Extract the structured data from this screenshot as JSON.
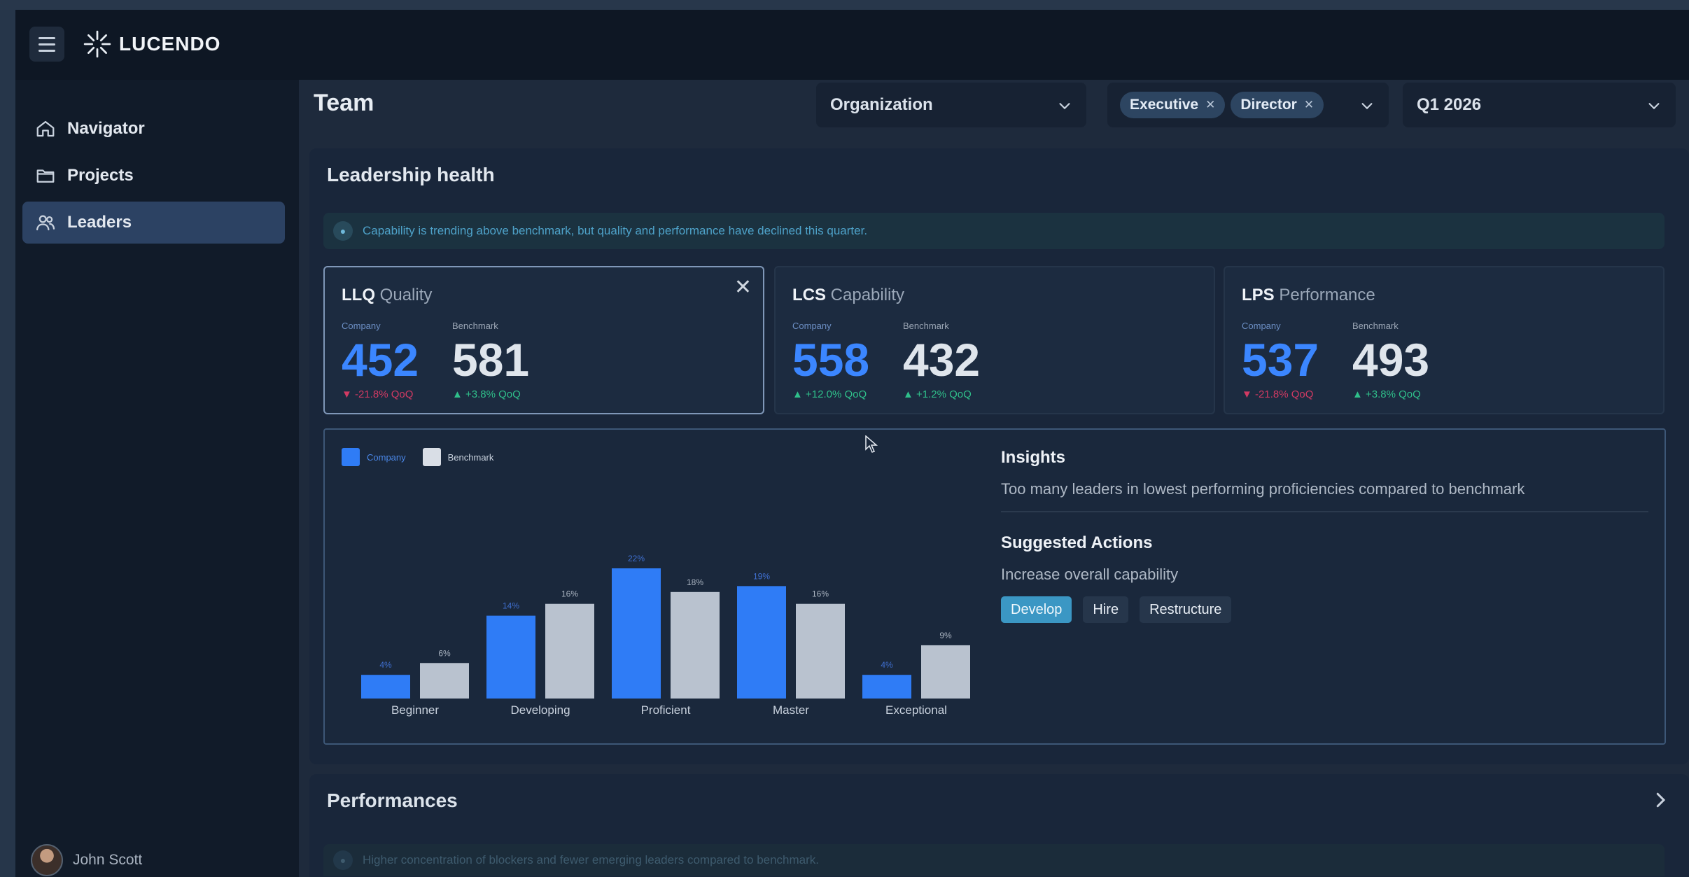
{
  "app": {
    "name": "LUCENDO"
  },
  "nav": {
    "items": [
      {
        "label": "Navigator",
        "icon": "home-icon",
        "active": false
      },
      {
        "label": "Projects",
        "icon": "folder-icon",
        "active": false
      },
      {
        "label": "Leaders",
        "icon": "users-icon",
        "active": true
      }
    ]
  },
  "user": {
    "name": "John Scott"
  },
  "header": {
    "title": "Team",
    "org_select": {
      "value": "Organization"
    },
    "role_filter": {
      "chips": [
        "Executive",
        "Director"
      ]
    },
    "period_select": {
      "value": "Q1 2026"
    }
  },
  "leadership": {
    "title": "Leadership health",
    "banner": "Capability is trending above benchmark, but quality and performance have declined this quarter.",
    "metrics": [
      {
        "code": "LLQ",
        "name": "Quality",
        "company_label": "Company",
        "company_value": "452",
        "company_delta": "▼ -21.8% QoQ",
        "company_dir": "down",
        "bench_label": "Benchmark",
        "bench_value": "581",
        "bench_delta": "▲ +3.8% QoQ",
        "selected": true
      },
      {
        "code": "LCS",
        "name": "Capability",
        "company_label": "Company",
        "company_value": "558",
        "company_delta": "▲ +12.0% QoQ",
        "company_dir": "up",
        "bench_label": "Benchmark",
        "bench_value": "432",
        "bench_delta": "▲ +1.2% QoQ",
        "selected": false
      },
      {
        "code": "LPS",
        "name": "Performance",
        "company_label": "Company",
        "company_value": "537",
        "company_delta": "▼ -21.8% QoQ",
        "company_dir": "down",
        "bench_label": "Benchmark",
        "bench_value": "493",
        "bench_delta": "▲ +3.8% QoQ",
        "selected": false
      }
    ],
    "insights": {
      "title": "Insights",
      "text": "Too many leaders in lowest performing proficiencies compared to benchmark",
      "suggested_title": "Suggested Actions",
      "suggested_text": "Increase overall capability",
      "actions": [
        "Develop",
        "Hire",
        "Restructure"
      ]
    }
  },
  "chart_data": {
    "type": "bar",
    "categories": [
      "Beginner",
      "Developing",
      "Proficient",
      "Master",
      "Exceptional"
    ],
    "series": [
      {
        "name": "Company",
        "values": [
          4,
          14,
          22,
          19,
          4
        ],
        "color": "#2f7cf6"
      },
      {
        "name": "Benchmark",
        "values": [
          6,
          16,
          18,
          16,
          9
        ],
        "color": "#b9c2cf"
      }
    ],
    "value_suffix": "%",
    "legend": "top-left"
  },
  "performances": {
    "title": "Performances",
    "banner": "Higher concentration of blockers and fewer emerging leaders compared to benchmark."
  },
  "colors": {
    "accent": "#3b86ff",
    "primary_button": "#3b97c4",
    "positive": "#2fbf8a",
    "negative": "#d23a63"
  }
}
